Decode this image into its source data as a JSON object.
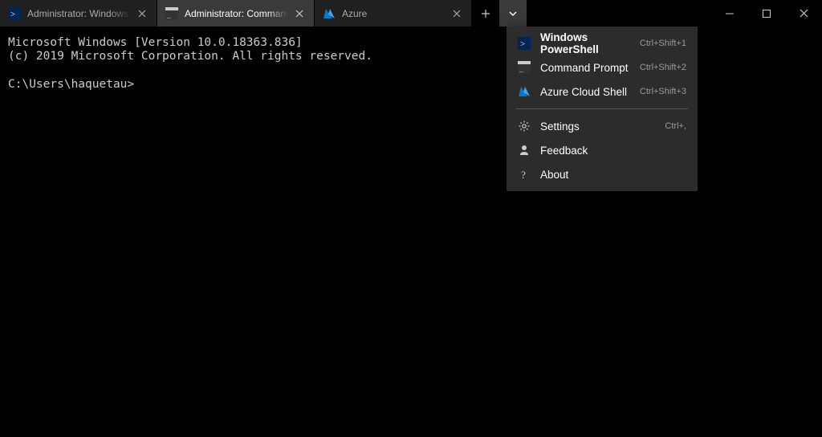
{
  "tabs": [
    {
      "title": "Administrator: Windows PowerShell",
      "icon": "powershell"
    },
    {
      "title": "Administrator: Command Prompt",
      "icon": "cmd"
    },
    {
      "title": "Azure",
      "icon": "azure"
    }
  ],
  "activeTabIndex": 1,
  "terminal": {
    "line1": "Microsoft Windows [Version 10.0.18363.836]",
    "line2": "(c) 2019 Microsoft Corporation. All rights reserved.",
    "prompt": "C:\\Users\\haquetau>"
  },
  "dropdown": {
    "profiles": [
      {
        "label": "Windows PowerShell",
        "shortcut": "Ctrl+Shift+1",
        "icon": "powershell",
        "bold": true
      },
      {
        "label": "Command Prompt",
        "shortcut": "Ctrl+Shift+2",
        "icon": "cmd",
        "bold": false
      },
      {
        "label": "Azure Cloud Shell",
        "shortcut": "Ctrl+Shift+3",
        "icon": "azure",
        "bold": false
      }
    ],
    "actions": [
      {
        "label": "Settings",
        "shortcut": "Ctrl+,",
        "icon": "gear"
      },
      {
        "label": "Feedback",
        "shortcut": "",
        "icon": "feedback"
      },
      {
        "label": "About",
        "shortcut": "",
        "icon": "question"
      }
    ]
  }
}
